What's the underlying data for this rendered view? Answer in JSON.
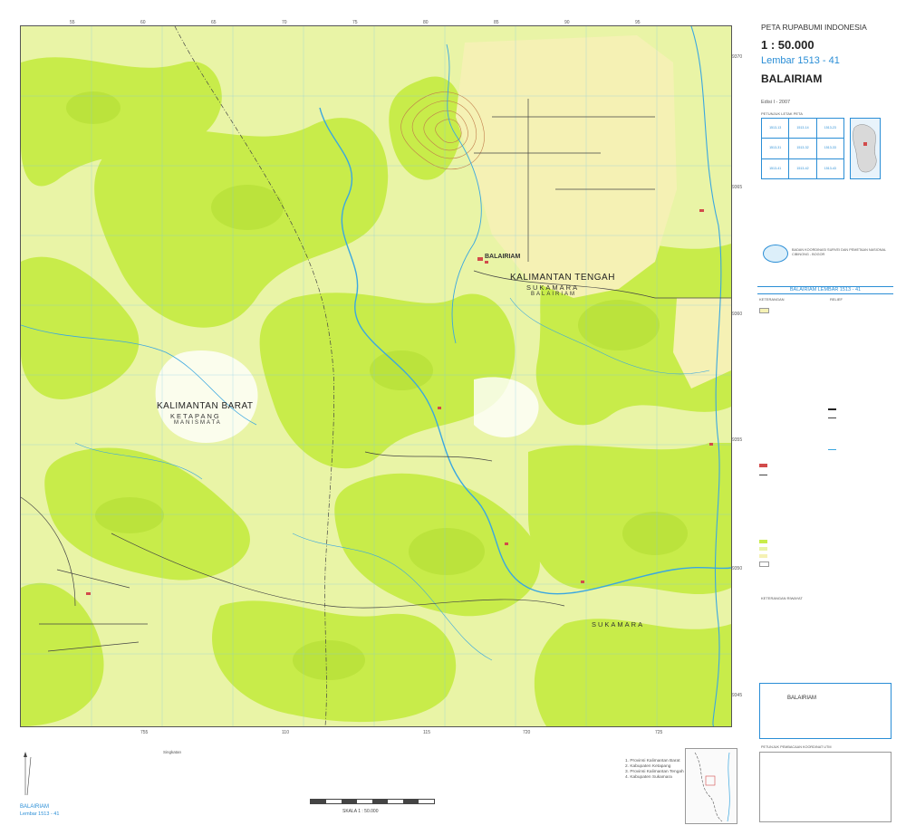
{
  "header": {
    "series": "PETA RUPABUMI INDONESIA",
    "scale": "1 : 50.000",
    "sheet": "Lembar 1513 - 41",
    "name": "BALAIRIAM",
    "edition": "Edisi I - 2007"
  },
  "colors": {
    "map_background": "#f4f7df",
    "vegetation_light": "#e9f4a6",
    "vegetation": "#c8ec4a",
    "vegetation_dense": "#b9e23a",
    "settlement_plain": "#f5f1b4",
    "relief_contours": "#c07d4b",
    "river": "#3aa7e0",
    "road": "#444444",
    "accent_blue": "#2a8ed6"
  },
  "map": {
    "places": {
      "balairiam": "BALAIRIAM",
      "kalteng": "KALIMANTAN TENGAH",
      "sukamara_kab": "SUKAMARA",
      "balairiam_kec": "BALAIRIAM",
      "kalbar": "KALIMANTAN BARAT",
      "ketapang": "KETAPANG",
      "manismata": "MANISMATA",
      "sukamara_se": "SUKAMARA"
    },
    "grid_top": [
      "55",
      "60",
      "65",
      "70",
      "75",
      "80",
      "85",
      "90",
      "95"
    ],
    "grid_bottom": [
      "755",
      "110",
      "115",
      "720",
      "725"
    ],
    "grid_right": [
      "9370",
      "9365",
      "9360",
      "9355",
      "9350",
      "9345"
    ]
  },
  "side_panel": {
    "location_box_title": "PETUNJUK LETAK PETA",
    "location_cells": [
      "1513-13",
      "1513-14",
      "1513-23",
      "1513-31",
      "1513-32",
      "1513-33",
      "1513-41",
      "1513-42",
      "1513-43"
    ],
    "agency_lines": [
      "BADAN KOORDINASI SURVEI DAN PEMETAAN NASIONAL",
      "CIBINONG - BOGOR"
    ],
    "banner": "BALAIRIAM   LEMBAR 1513 - 41",
    "legend_title": "KETERANGAN",
    "relief_title": "RELIEF",
    "notes_title": "KETERANGAN RIWAYAT",
    "place_index_name": "BALAIRIAM",
    "declination_title": "PETUNJUK PEMBACAAN KOORDINAT UTM"
  },
  "bottom": {
    "sheet_name": "BALAIRIAM",
    "sheet_number": "Lembar 1513 - 41",
    "abbreviations_title": "Singkatan",
    "scale_text": "SKALA 1 : 50.000",
    "regions": [
      "1. Provinsi Kalimantan Barat",
      "2. Kabupaten Ketapang",
      "3. Provinsi Kalimantan Tengah",
      "4. Kabupaten Sukamara"
    ]
  }
}
